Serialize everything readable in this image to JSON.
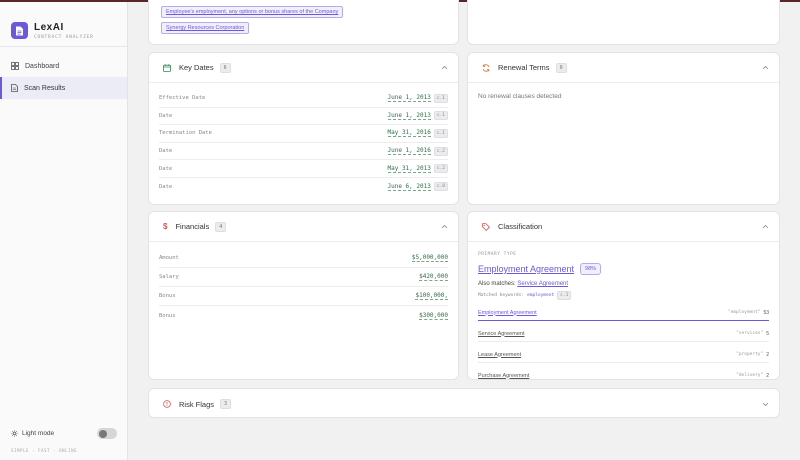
{
  "app": {
    "name": "LexAI",
    "subtitle": "CONTRACT ANALYZER"
  },
  "sidebar": {
    "items": [
      {
        "label": "Dashboard",
        "icon": "dashboard-icon",
        "active": false
      },
      {
        "label": "Scan Results",
        "icon": "document-icon",
        "active": true
      }
    ],
    "light_mode_label": "Light mode",
    "footer": "SIMPLE · FAST · ONLINE"
  },
  "parties_card": {
    "tags": [
      "Employee's employment, any options or bonus shares of the Company",
      "Synergy Resources Corporation"
    ]
  },
  "key_dates": {
    "title": "Key Dates",
    "count": "6",
    "rows": [
      {
        "label": "Effective Date",
        "value": "June 1, 2013",
        "ref": "c.1"
      },
      {
        "label": "Date",
        "value": "June 1, 2013",
        "ref": "c.1"
      },
      {
        "label": "Termination Date",
        "value": "May 31, 2016",
        "ref": "c.1"
      },
      {
        "label": "Date",
        "value": "June 1, 2016",
        "ref": "c.2"
      },
      {
        "label": "Date",
        "value": "May 31, 2013",
        "ref": "c.2"
      },
      {
        "label": "Date",
        "value": "June 6, 2013",
        "ref": "c.8"
      }
    ]
  },
  "renewal_terms": {
    "title": "Renewal Terms",
    "count": "0",
    "empty_text": "No renewal clauses detected"
  },
  "financials": {
    "title": "Financials",
    "count": "4",
    "rows": [
      {
        "label": "Amount",
        "value": "$5,000,000"
      },
      {
        "label": "Salary",
        "value": "$420,000"
      },
      {
        "label": "Bonus",
        "value": "$100,000,"
      },
      {
        "label": "Bonus",
        "value": "$300,000"
      }
    ]
  },
  "classification": {
    "title": "Classification",
    "primary_label": "PRIMARY TYPE",
    "primary_value": "Employment Agreement",
    "confidence": "98%",
    "also_prefix": "Also matches:",
    "also_value": "Service Agreement",
    "keywords_label": "Matched keywords:",
    "keywords_value": "employment",
    "keywords_ref": "c.1",
    "matches": [
      {
        "name": "Employment Agreement",
        "keyword": "\"employment\"",
        "count": "53"
      },
      {
        "name": "Service Agreement",
        "keyword": "\"services\"",
        "count": "5"
      },
      {
        "name": "Lease Agreement",
        "keyword": "\"property\"",
        "count": "2"
      },
      {
        "name": "Purchase Agreement",
        "keyword": "\"delivery\"",
        "count": "2"
      }
    ]
  },
  "risk_flags": {
    "title": "Risk Flags",
    "count": "3"
  },
  "colors": {
    "accent": "#6a5ad9",
    "money": "#2f6e4a",
    "warning": "#d9534f",
    "renewal": "#e0703a"
  }
}
